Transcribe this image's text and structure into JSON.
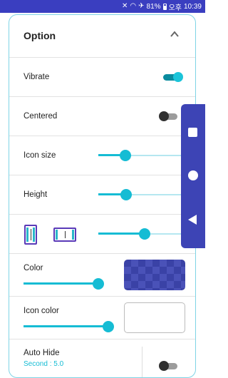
{
  "status_bar": {
    "battery": "81%",
    "network_label": "오후",
    "time": "10:39"
  },
  "panel": {
    "title": "Option",
    "collapse_icon": "chevron-up-icon"
  },
  "settings": {
    "vibrate": {
      "label": "Vibrate",
      "enabled": true
    },
    "centered": {
      "label": "Centered",
      "enabled": false
    },
    "icon_size": {
      "label": "Icon size",
      "value": 0.29
    },
    "height": {
      "label": "Height",
      "value": 0.3
    },
    "width_mode": {
      "value": 0.5
    },
    "color": {
      "label": "Color",
      "value": 0.95,
      "swatch": "#3a42a6"
    },
    "icon_color": {
      "label": "Icon color",
      "value": 0.98,
      "swatch": "#ffffff"
    },
    "auto_hide": {
      "label": "Auto Hide",
      "sublabel": "Second : 5.0",
      "enabled": false
    }
  },
  "floating_nav": {
    "background": "#3d44b5",
    "buttons": [
      "square-icon",
      "circle-icon",
      "back-triangle-icon"
    ]
  },
  "colors": {
    "accent": "#15bcd4",
    "status_bar": "#3a3ec0"
  }
}
